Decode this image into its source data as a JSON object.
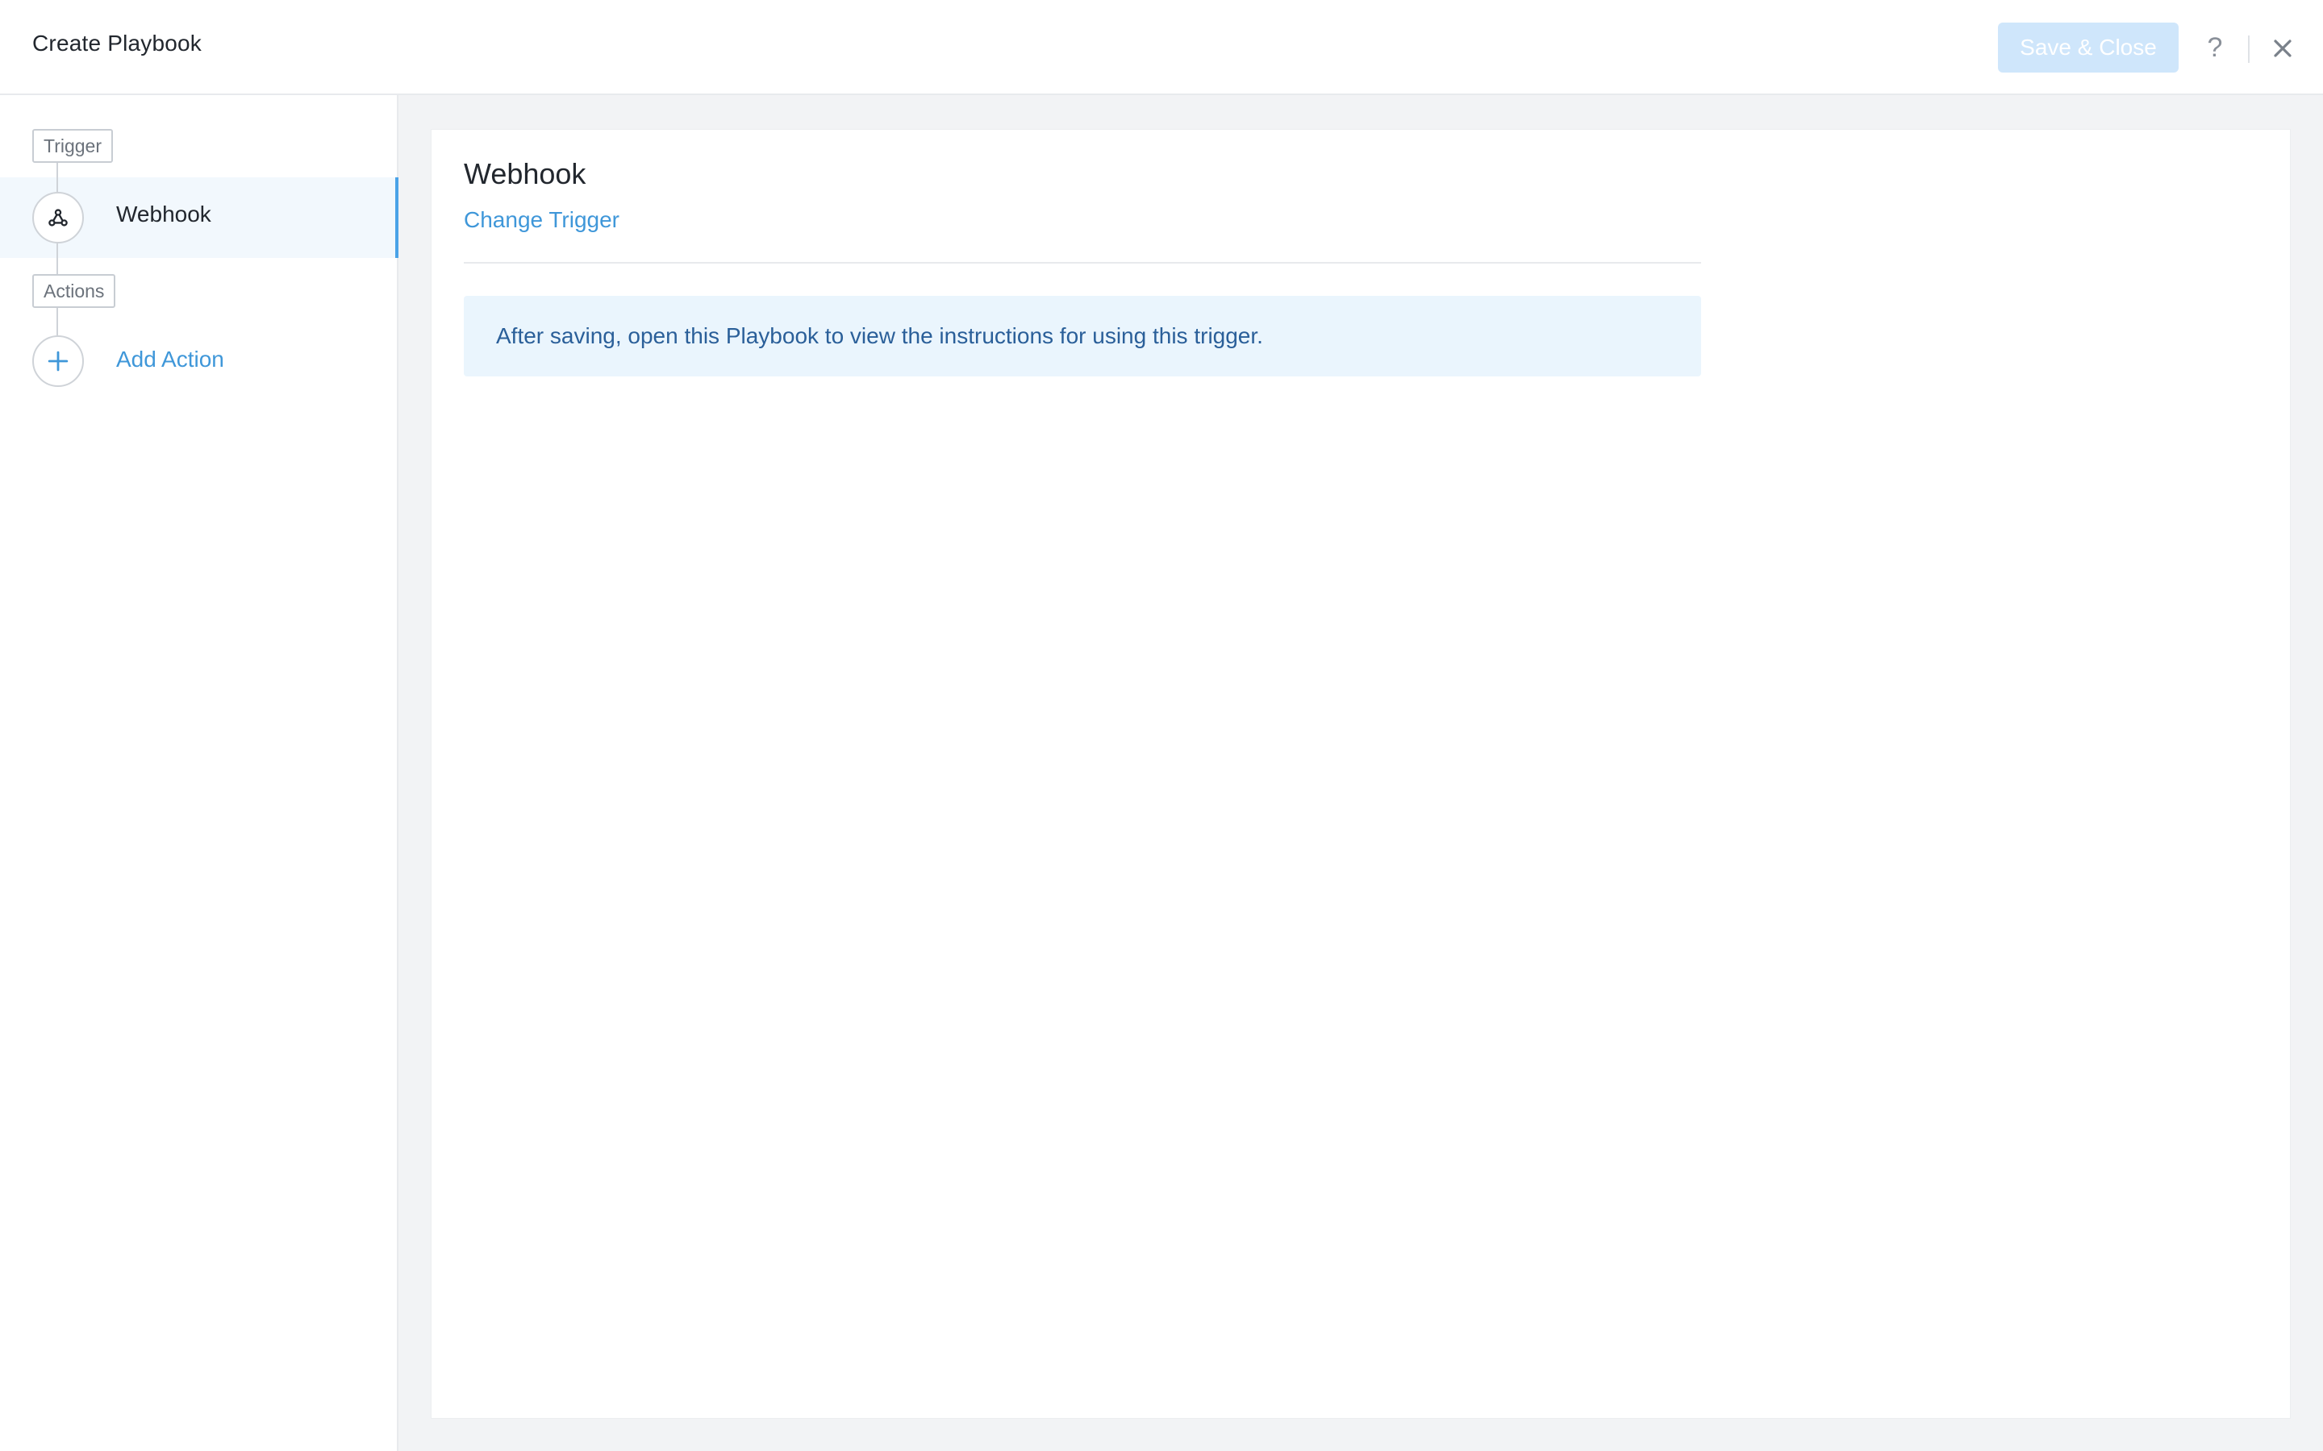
{
  "header": {
    "title": "Create Playbook",
    "save_label": "Save & Close",
    "help_label": "?"
  },
  "sidebar": {
    "trigger_tag": "Trigger",
    "trigger_item": {
      "label": "Webhook",
      "icon": "webhook-icon",
      "selected": true
    },
    "actions_tag": "Actions",
    "add_action": {
      "label": "Add Action",
      "icon": "plus-icon"
    }
  },
  "main": {
    "title": "Webhook",
    "change_trigger_label": "Change Trigger",
    "info_message": "After saving, open this Playbook to view the instructions for using this trigger."
  },
  "colors": {
    "accent": "#3f97d9",
    "save_disabled_bg": "#cfe6fb",
    "selected_row_bg": "#f2f8fd",
    "info_bg": "#eaf5fd",
    "info_text": "#2a5f99",
    "page_bg": "#f2f3f5"
  }
}
